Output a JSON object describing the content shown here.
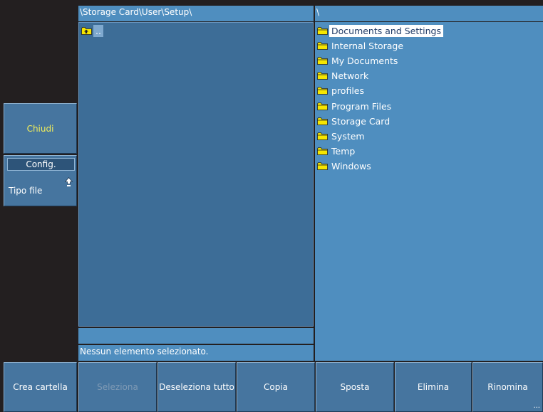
{
  "sidebar": {
    "close_label": "Chiudi",
    "config_tab": "Config.",
    "file_type_label": "Tipo file"
  },
  "left_panel": {
    "path": "\\Storage Card\\User\\Setup\\",
    "items": [
      {
        "name": "..",
        "icon": "folder-up-icon"
      }
    ],
    "status": "Nessun elemento selezionato."
  },
  "right_panel": {
    "path": "\\",
    "selected_index": 0,
    "items": [
      {
        "name": "Documents and Settings",
        "icon": "folder-icon"
      },
      {
        "name": "Internal Storage",
        "icon": "folder-icon"
      },
      {
        "name": "My Documents",
        "icon": "folder-icon"
      },
      {
        "name": "Network",
        "icon": "folder-icon"
      },
      {
        "name": "profiles",
        "icon": "folder-icon"
      },
      {
        "name": "Program Files",
        "icon": "folder-icon"
      },
      {
        "name": "Storage Card",
        "icon": "folder-icon"
      },
      {
        "name": "System",
        "icon": "folder-icon"
      },
      {
        "name": "Temp",
        "icon": "folder-icon"
      },
      {
        "name": "Windows",
        "icon": "folder-icon"
      }
    ]
  },
  "toolbar": {
    "new_folder": "Crea cartella",
    "select": "Seleziona",
    "deselect_all": "Deseleziona tutto",
    "copy": "Copia",
    "move": "Sposta",
    "delete": "Elimina",
    "rename": "Rinomina",
    "more": "..."
  },
  "colors": {
    "background": "#231f20",
    "button": "#46759f",
    "panel_header": "#4f8ebf",
    "left_list": "#3d6d97",
    "close_text": "#f2ee5a",
    "folder": "#f6e600"
  }
}
